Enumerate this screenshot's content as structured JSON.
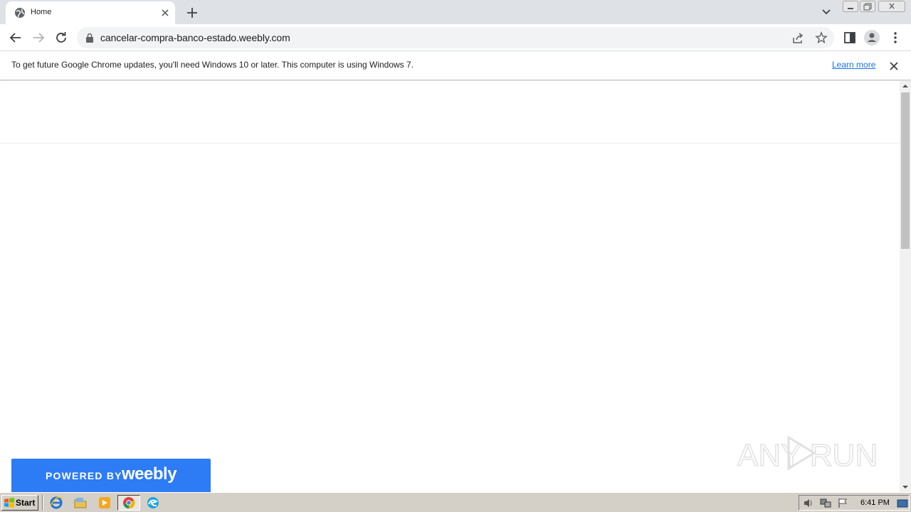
{
  "browser": {
    "tab": {
      "title": "Home"
    },
    "omnibox": {
      "url": "cancelar-compra-banco-estado.weebly.com"
    },
    "infobar": {
      "message": "To get future Google Chrome updates, you'll need Windows 10 or later. This computer is using Windows 7.",
      "link_label": "Learn more"
    }
  },
  "page": {
    "badge": {
      "powered_label": "POWERED BY",
      "brand": "weebly"
    },
    "watermark": "ANY RUN"
  },
  "taskbar": {
    "start_label": "Start",
    "clock": "6:41 PM"
  },
  "colors": {
    "accent": "#1a73e8",
    "weebly_blue": "#2d7bf5",
    "tabstrip": "#dee1e6"
  }
}
